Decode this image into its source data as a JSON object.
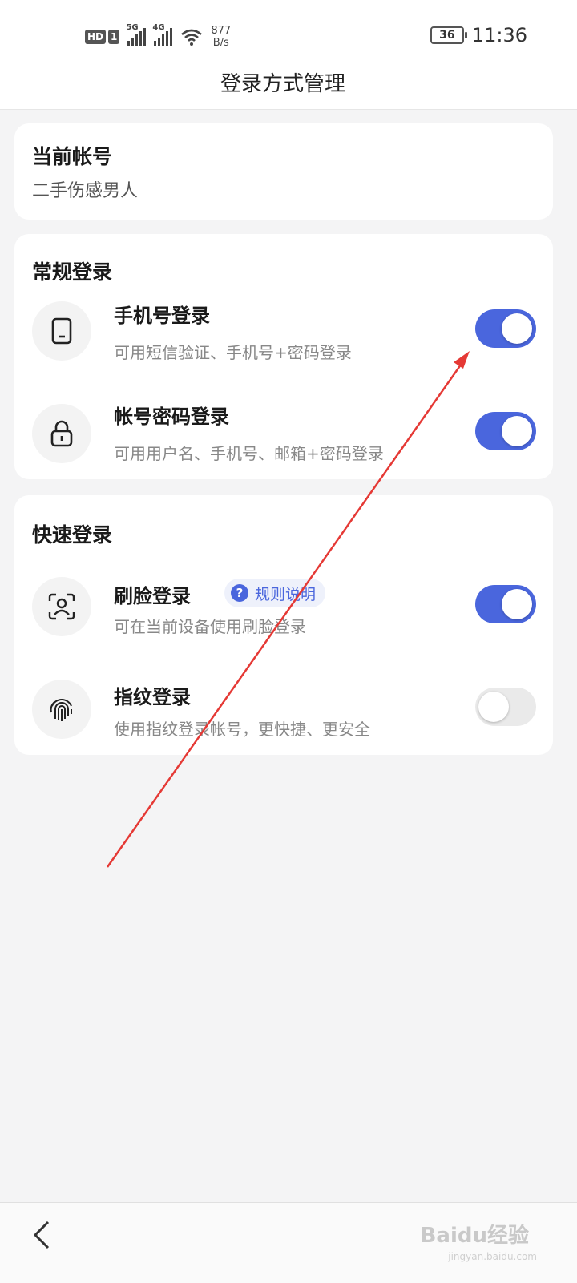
{
  "status": {
    "hd": "HD",
    "sim": "1",
    "sig1": "5G",
    "sig2": "4G",
    "net_speed": "877",
    "net_unit": "B/s",
    "battery": "36",
    "time": "11:36"
  },
  "header": {
    "title": "登录方式管理"
  },
  "account": {
    "label": "当前帐号",
    "name": "二手伤感男人"
  },
  "regular": {
    "title": "常规登录",
    "items": [
      {
        "title": "手机号登录",
        "desc": "可用短信验证、手机号+密码登录",
        "icon": "phone-icon",
        "enabled": true
      },
      {
        "title": "帐号密码登录",
        "desc": "可用用户名、手机号、邮箱+密码登录",
        "icon": "lock-icon",
        "enabled": true
      }
    ]
  },
  "quick": {
    "title": "快速登录",
    "items": [
      {
        "title": "刷脸登录",
        "desc": "可在当前设备使用刷脸登录",
        "icon": "face-scan-icon",
        "enabled": true,
        "badge": "规则说明",
        "badge_icon": "?"
      },
      {
        "title": "指纹登录",
        "desc": "使用指纹登录帐号，更快捷、更安全",
        "icon": "fingerprint-icon",
        "enabled": false
      }
    ]
  },
  "watermark": {
    "text": "Baidu经验",
    "sub": "jingyan.baidu.com"
  },
  "colors": {
    "accent": "#4a66dd",
    "annotation": "#e53935",
    "background": "#f4f4f5"
  }
}
